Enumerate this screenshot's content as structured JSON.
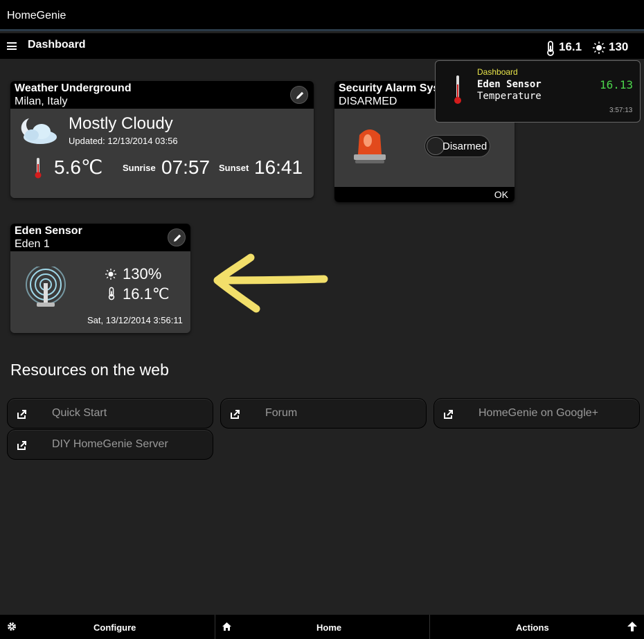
{
  "app": {
    "title": "HomeGenie"
  },
  "navbar": {
    "page_title": "Dashboard",
    "temperature": "16.1",
    "luminance": "130"
  },
  "weather": {
    "title": "Weather Underground",
    "location": "Milan, Italy",
    "condition": "Mostly Cloudy",
    "updated": "Updated: 12/13/2014 03:56",
    "temperature": "5.6℃",
    "sunrise_label": "Sunrise",
    "sunrise": "07:57",
    "sunset_label": "Sunset",
    "sunset": "16:41"
  },
  "security": {
    "title": "Security Alarm System",
    "status": "DISARMED",
    "toggle_label": "Disarmed",
    "ok_label": "OK"
  },
  "notification": {
    "source": "Dashboard",
    "name": "Eden Sensor",
    "parameter": "Temperature",
    "value": "16.13",
    "time": "3:57:13"
  },
  "eden": {
    "title": "Eden Sensor",
    "subtitle": "Eden 1",
    "luminance": "130%",
    "temperature": "16.1℃",
    "timestamp": "Sat, 13/12/2014 3:56:11"
  },
  "resources": {
    "title": "Resources on the web",
    "links": [
      "Quick Start",
      "Forum",
      "HomeGenie on Google+",
      "DIY HomeGenie Server"
    ]
  },
  "bottombar": {
    "configure": "Configure",
    "home": "Home",
    "actions": "Actions"
  },
  "colors": {
    "notif_source": "#e8e44a",
    "notif_value": "#4bd44b",
    "arrow": "#f2df6a"
  }
}
